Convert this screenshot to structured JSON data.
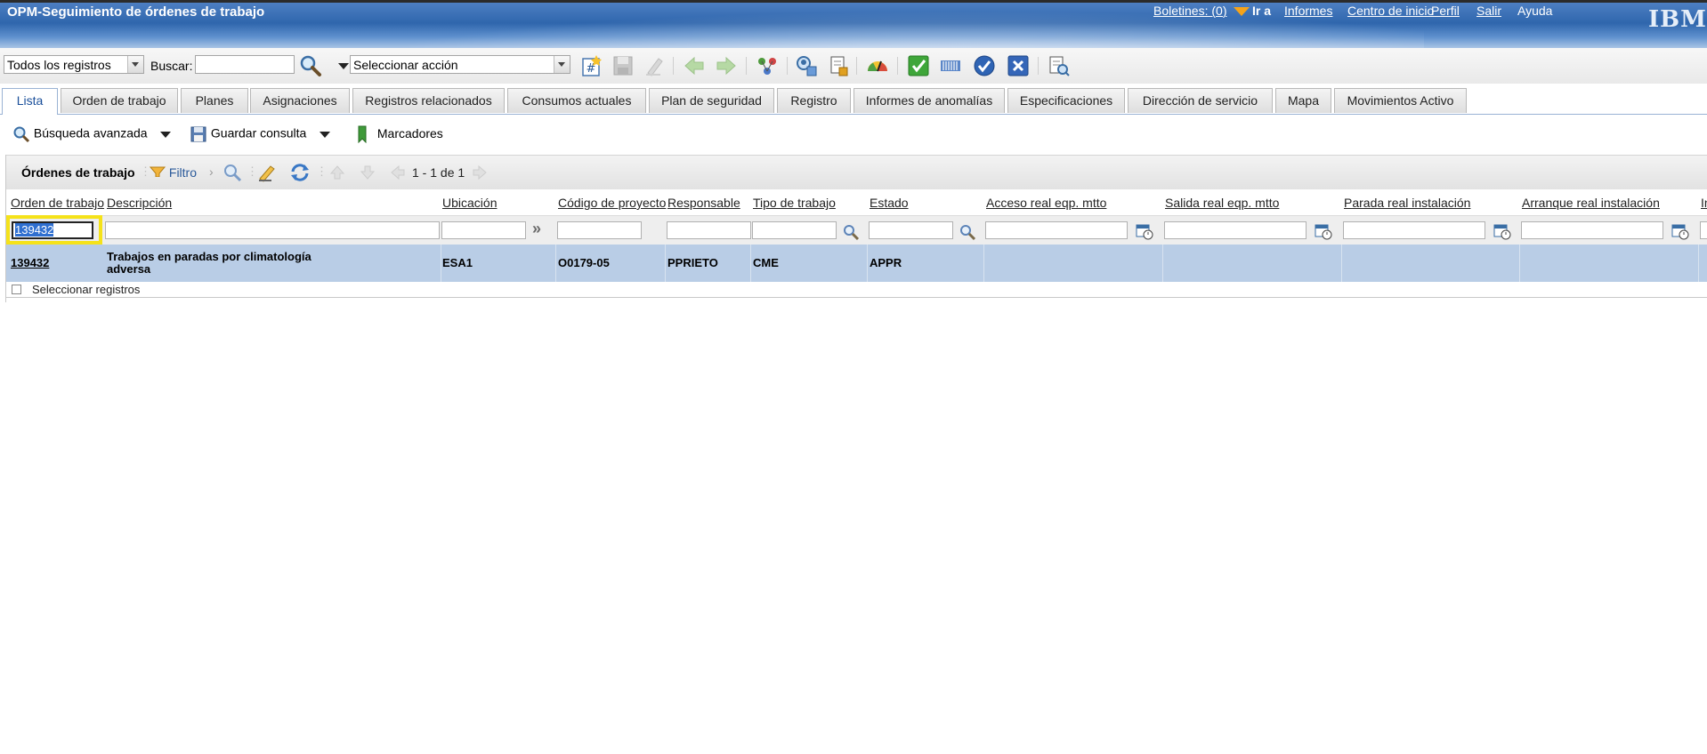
{
  "header": {
    "app_title": "OPM-Seguimiento de órdenes de trabajo",
    "boletines": "Boletines: (0)",
    "goto": "Ir a",
    "informes": "Informes",
    "centro": "Centro de inicio",
    "perfil": "Perfil",
    "salir": "Salir",
    "ayuda": "Ayuda",
    "logo": "IBM."
  },
  "toolbar": {
    "records_filter": "Todos los registros",
    "search_label": "Buscar:",
    "search_value": "",
    "action_select": "Seleccionar acción"
  },
  "tabs": [
    {
      "label": "Lista",
      "active": true
    },
    {
      "label": "Orden de trabajo"
    },
    {
      "label": "Planes"
    },
    {
      "label": "Asignaciones"
    },
    {
      "label": "Registros relacionados"
    },
    {
      "label": "Consumos actuales"
    },
    {
      "label": "Plan de seguridad"
    },
    {
      "label": "Registro"
    },
    {
      "label": "Informes de anomalías"
    },
    {
      "label": "Especificaciones"
    },
    {
      "label": "Dirección de servicio"
    },
    {
      "label": "Mapa"
    },
    {
      "label": "Movimientos Activo"
    }
  ],
  "querybar": {
    "advanced_search": "Búsqueda avanzada",
    "save_query": "Guardar consulta",
    "bookmarks": "Marcadores"
  },
  "table": {
    "title": "Órdenes de trabajo",
    "filter_label": "Filtro",
    "pagination": "1 - 1 de 1",
    "columns": [
      "Orden de trabajo",
      "Descripción",
      "Ubicación",
      "Código de proyecto",
      "Responsable",
      "Tipo de trabajo",
      "Estado",
      "Acceso real eqp. mtto",
      "Salida real eqp. mtto",
      "Parada real instalación",
      "Arranque real instalación",
      "In"
    ],
    "filter_values": {
      "orden": "139432"
    },
    "rows": [
      {
        "orden": "139432",
        "descripcion_l1": "Trabajos en paradas por climatología",
        "descripcion_l2": "adversa",
        "ubicacion": "ESA1",
        "codigo_proyecto": "O0179-05",
        "responsable": "PPRIETO",
        "tipo_trabajo": "CME",
        "estado": "APPR"
      }
    ],
    "select_records": "Seleccionar registros"
  },
  "colors": {
    "banner": "#2f66ad",
    "selected_row": "#b9cde6",
    "highlight_box": "#f5e21a",
    "active_tab_text": "#1a4f9a"
  }
}
